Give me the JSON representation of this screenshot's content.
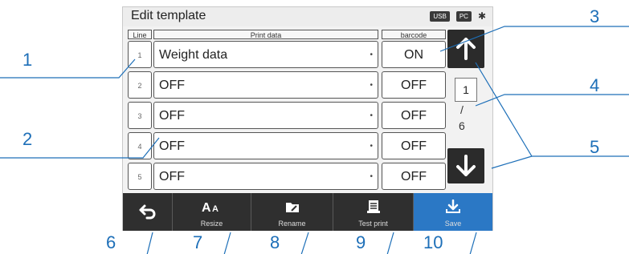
{
  "screen": {
    "title": "Edit template",
    "status": {
      "usb_badge": "USB",
      "pc_badge": "PC",
      "bt_icon": "bluetooth-icon"
    }
  },
  "table": {
    "headers": {
      "line": "Line",
      "print_data": "Print data",
      "barcode": "barcode"
    },
    "rows": [
      {
        "line": "1",
        "print_data": "Weight data",
        "barcode": "ON"
      },
      {
        "line": "2",
        "print_data": "OFF",
        "barcode": "OFF"
      },
      {
        "line": "3",
        "print_data": "OFF",
        "barcode": "OFF"
      },
      {
        "line": "4",
        "print_data": "OFF",
        "barcode": "OFF"
      },
      {
        "line": "5",
        "print_data": "OFF",
        "barcode": "OFF"
      }
    ],
    "cell_marker": "•"
  },
  "paging": {
    "current": "1",
    "slash": "/",
    "total": "6"
  },
  "toolbar": {
    "back_icon": "return-arrow-icon",
    "resize": "Resize",
    "rename": "Rename",
    "test_print": "Test print",
    "save": "Save"
  },
  "callouts": {
    "n1": "1",
    "n2": "2",
    "n3": "3",
    "n4": "4",
    "n5": "5",
    "n6": "6",
    "n7": "7",
    "n8": "8",
    "n9": "9",
    "n10": "10"
  },
  "colors": {
    "accent": "#2b78c5",
    "callout": "#1d6fb8",
    "button": "#2f2f2f"
  }
}
